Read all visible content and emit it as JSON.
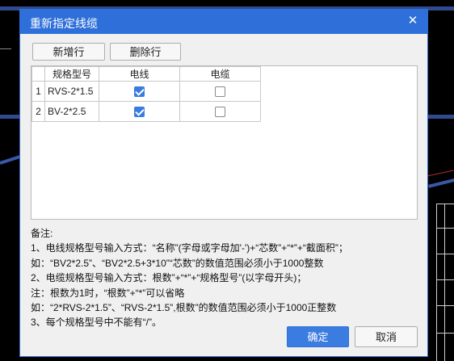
{
  "dialog": {
    "title": "重新指定线缆",
    "close_icon": "close-icon"
  },
  "toolbar": {
    "add_row_label": "新增行",
    "delete_row_label": "删除行"
  },
  "table": {
    "headers": [
      "",
      "规格型号",
      "电线",
      "电缆"
    ],
    "rows": [
      {
        "index": "1",
        "spec": "RVS-2*1.5",
        "wire": true,
        "cable": false
      },
      {
        "index": "2",
        "spec": "BV-2*2.5",
        "wire": true,
        "cable": false
      }
    ]
  },
  "notes": {
    "lines": [
      "备注:",
      "1、电线规格型号输入方式：“名称”(字母或字母加'-')+“芯数”+“*”+“截面积”；",
      "如：“BV2*2.5”、“BV2*2.5+3*10”“芯数”的数值范围必须小于1000整数",
      "2、电缆规格型号输入方式：根数”+“*”+“规格型号”(以字母开头)；",
      "注：根数为1时，“根数”+“*”可以省略",
      "如：“2*RVS-2*1.5”、“RVS-2*1.5”,根数”的数值范围必须小于1000正整数",
      "3、每个规格型号中不能有“/”。"
    ]
  },
  "footer": {
    "ok_label": "确定",
    "cancel_label": "取消"
  },
  "colors": {
    "titlebar": "#2e6fd9",
    "primary_button": "#3b7ce0",
    "checkbox_checked": "#3b7ce0"
  }
}
